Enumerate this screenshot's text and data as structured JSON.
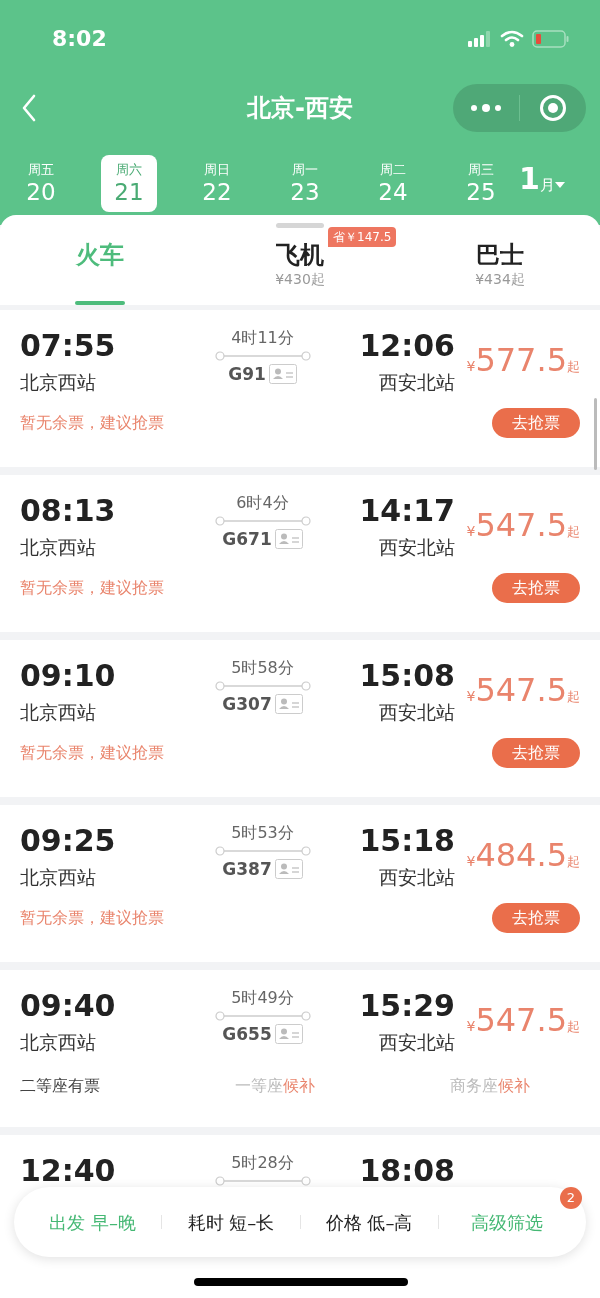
{
  "status_bar": {
    "time": "8:02"
  },
  "nav": {
    "title": "北京-西安"
  },
  "dates": [
    {
      "weekday": "周五",
      "day": "20",
      "selected": false
    },
    {
      "weekday": "周六",
      "day": "21",
      "selected": true
    },
    {
      "weekday": "周日",
      "day": "22",
      "selected": false
    },
    {
      "weekday": "周一",
      "day": "23",
      "selected": false
    },
    {
      "weekday": "周二",
      "day": "24",
      "selected": false
    },
    {
      "weekday": "周三",
      "day": "25",
      "selected": false
    }
  ],
  "month": {
    "number": "1",
    "unit": "月"
  },
  "tabs": [
    {
      "label": "火车",
      "selected": true
    },
    {
      "label": "飞机",
      "selected": false,
      "sub": "¥430起",
      "badge": "省￥147.5"
    },
    {
      "label": "巴士",
      "selected": false,
      "sub": "¥434起"
    }
  ],
  "trains": [
    {
      "kind": "sold_out",
      "depart": "07:55",
      "from": "北京西站",
      "duration": "4时11分",
      "number": "G91",
      "arrive": "12:06",
      "to": "西安北站",
      "currency": "¥",
      "price": "577.5",
      "suffix": "起",
      "note": "暂无余票，建议抢票",
      "button": "去抢票"
    },
    {
      "kind": "sold_out",
      "depart": "08:13",
      "from": "北京西站",
      "duration": "6时4分",
      "number": "G671",
      "arrive": "14:17",
      "to": "西安北站",
      "currency": "¥",
      "price": "547.5",
      "suffix": "起",
      "note": "暂无余票，建议抢票",
      "button": "去抢票"
    },
    {
      "kind": "sold_out",
      "depart": "09:10",
      "from": "北京西站",
      "duration": "5时58分",
      "number": "G307",
      "arrive": "15:08",
      "to": "西安北站",
      "currency": "¥",
      "price": "547.5",
      "suffix": "起",
      "note": "暂无余票，建议抢票",
      "button": "去抢票"
    },
    {
      "kind": "sold_out",
      "depart": "09:25",
      "from": "北京西站",
      "duration": "5时53分",
      "number": "G387",
      "arrive": "15:18",
      "to": "西安北站",
      "currency": "¥",
      "price": "484.5",
      "suffix": "起",
      "note": "暂无余票，建议抢票",
      "button": "去抢票"
    },
    {
      "kind": "seats",
      "depart": "09:40",
      "from": "北京西站",
      "duration": "5时49分",
      "number": "G655",
      "arrive": "15:29",
      "to": "西安北站",
      "currency": "¥",
      "price": "547.5",
      "suffix": "起",
      "seats": [
        {
          "seat": "二等座",
          "status": "有票",
          "available": true
        },
        {
          "seat": "一等座",
          "status": "候补",
          "available": false
        },
        {
          "seat": "商务座",
          "status": "候补",
          "available": false
        }
      ]
    },
    {
      "kind": "partial",
      "depart": "12:40",
      "duration": "5时28分",
      "arrive": "18:08"
    }
  ],
  "filter_bar": [
    {
      "label": "出发 早–晚",
      "active": true
    },
    {
      "label": "耗时 短–长",
      "active": false
    },
    {
      "label": "价格 低–高",
      "active": false
    },
    {
      "label": "高级筛选",
      "active": true,
      "badge": "2"
    }
  ]
}
